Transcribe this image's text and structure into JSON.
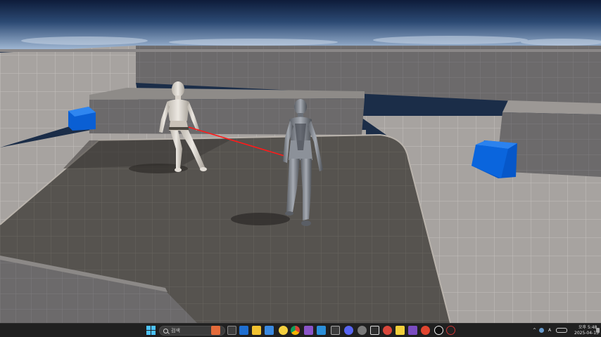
{
  "viewport": {
    "scene": "third-person-template-level",
    "colors": {
      "sky_top": "#0e1c3a",
      "sky_bottom": "#9fb6d2",
      "floor": "#7b7570",
      "floor_grid": "#a8a29b",
      "wall": "#6f6c6c",
      "cube": "#0a62d8",
      "trace_line": "#ff1a1a"
    }
  },
  "taskbar": {
    "search_label": "검색",
    "clock_time": "오후 5:48",
    "clock_date": "2025-04-13",
    "tray_lang": "A"
  },
  "icons": {
    "start": "windows-start-icon",
    "search": "search-icon",
    "apps": [
      "chrome-icon",
      "vscode-icon",
      "discord-icon",
      "unreal-icon"
    ]
  }
}
